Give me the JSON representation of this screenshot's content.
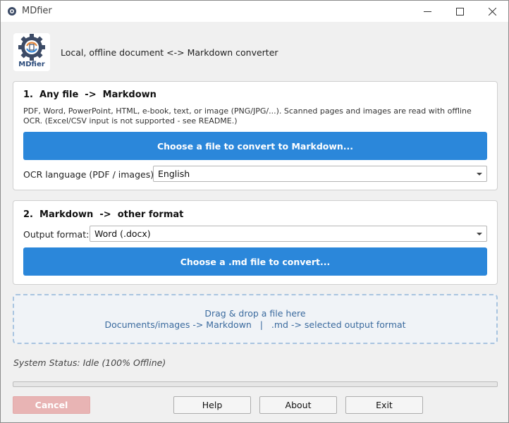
{
  "window": {
    "title": "MDfier",
    "controls": {
      "minimize": "—",
      "maximize": "☐",
      "close": "✕"
    }
  },
  "header": {
    "logo_text": "MDfier",
    "tagline": "Local, offline document <-> Markdown converter"
  },
  "section1": {
    "title": "1.  Any file  ->  Markdown",
    "description": "PDF, Word, PowerPoint, HTML, e-book, text, or image (PNG/JPG/...). Scanned pages and images are read with offline OCR. (Excel/CSV input is not supported - see README.)",
    "button_label": "Choose a file to convert to Markdown...",
    "ocr_label": "OCR language (PDF / images):",
    "ocr_value": "English"
  },
  "section2": {
    "title": "2.  Markdown  ->  other format",
    "format_label": "Output format:",
    "format_value": "Word (.docx)",
    "button_label": "Choose a .md file to convert..."
  },
  "dropzone": {
    "line1": "Drag & drop a file here",
    "line2": "Documents/images -> Markdown   |   .md -> selected output format"
  },
  "status": {
    "text": "System Status: Idle (100% Offline)",
    "progress": 0
  },
  "buttons": {
    "cancel": "Cancel",
    "help": "Help",
    "about": "About",
    "exit": "Exit"
  },
  "colors": {
    "accent": "#2b87da",
    "cancel_disabled": "#e8b4b4",
    "dropzone_text": "#3a6a9e"
  }
}
